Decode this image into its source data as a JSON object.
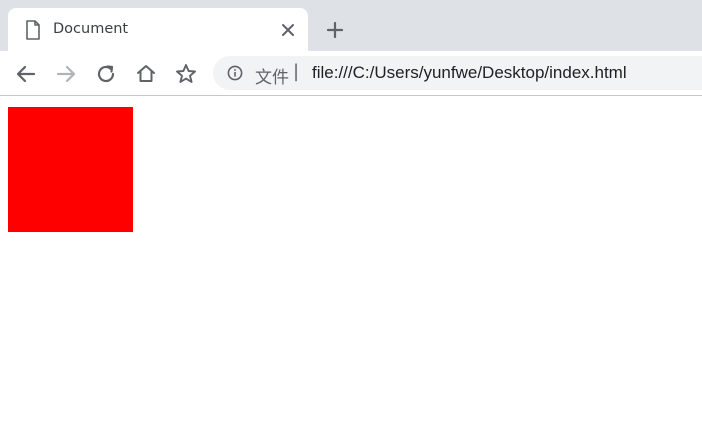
{
  "tab": {
    "title": "Document",
    "favicon": "document-icon"
  },
  "toolbar": {
    "back_icon": "arrow-left-icon",
    "forward_icon": "arrow-right-icon",
    "reload_icon": "reload-icon",
    "home_icon": "home-icon",
    "bookmark_icon": "star-icon"
  },
  "omnibox": {
    "security_icon": "info-icon",
    "prefix": "文件",
    "separator": "|",
    "url": "file:///C:/Users/yunfwe/Desktop/index.html"
  },
  "page": {
    "box_color": "#ff0000"
  },
  "colors": {
    "tabstrip_bg": "#dee1e6",
    "icon_color": "#5f6368",
    "disabled_icon_color": "#b0b3b8"
  }
}
